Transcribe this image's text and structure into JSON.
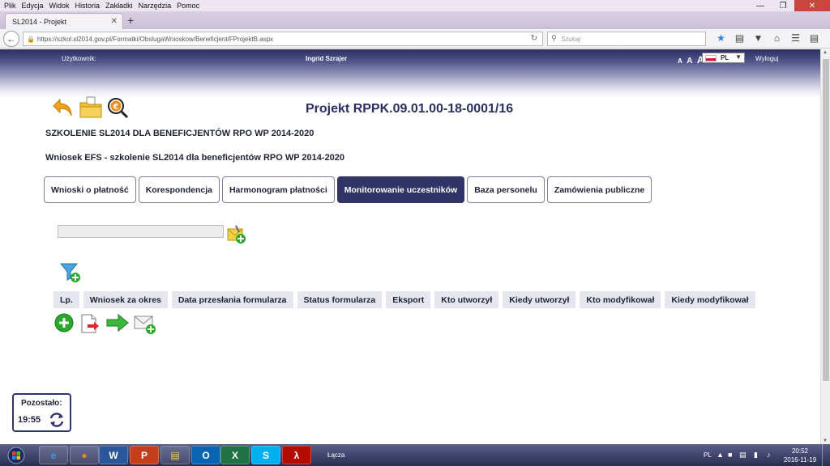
{
  "browser": {
    "menu": [
      "Plik",
      "Edycja",
      "Widok",
      "Historia",
      "Zakładki",
      "Narzędzia",
      "Pomoc"
    ],
    "tab_title": "SL2014 - Projekt",
    "url": "https://szkol.sl2014.gov.pl/Formatki/ObslugaWnioskow/Beneficjent/FProjektB.aspx",
    "search_placeholder": "Szukaj"
  },
  "header": {
    "user_label": "Użytkownik:",
    "user_name": "Ingrid Szrajer",
    "font_sizes": [
      "A",
      "A",
      "A"
    ],
    "language": "PL",
    "logout": "Wyloguj"
  },
  "project": {
    "title": "Projekt RPPK.09.01.00-18-0001/16",
    "subtitle1": "SZKOLENIE SL2014 DLA BENEFICJENTÓW RPO WP 2014-2020",
    "subtitle2": "Wniosek EFS - szkolenie SL2014 dla beneficjentów RPO WP 2014-2020"
  },
  "tabs": [
    {
      "label": "Wnioski o płatność",
      "active": false
    },
    {
      "label": "Korespondencja",
      "active": false
    },
    {
      "label": "Harmonogram płatności",
      "active": false
    },
    {
      "label": "Monitorowanie uczestników",
      "active": true
    },
    {
      "label": "Baza personelu",
      "active": false
    },
    {
      "label": "Zamówienia publiczne",
      "active": false
    }
  ],
  "columns": [
    "Lp.",
    "Wniosek za okres",
    "Data przesłania formularza",
    "Status formularza",
    "Eksport",
    "Kto utworzył",
    "Kiedy utworzył",
    "Kto modyfikował",
    "Kiedy modyfikował"
  ],
  "session": {
    "label": "Pozostało:",
    "time": "19:55"
  },
  "taskbar": {
    "active_window": "Łącza",
    "lang": "PL",
    "time": "20:52",
    "date": "2016-11-19",
    "apps": [
      "W",
      "P",
      "O",
      "X",
      "S"
    ]
  },
  "colors": {
    "accent": "#303466",
    "header_dark": "#2b2f62",
    "green": "#2aa82a"
  }
}
